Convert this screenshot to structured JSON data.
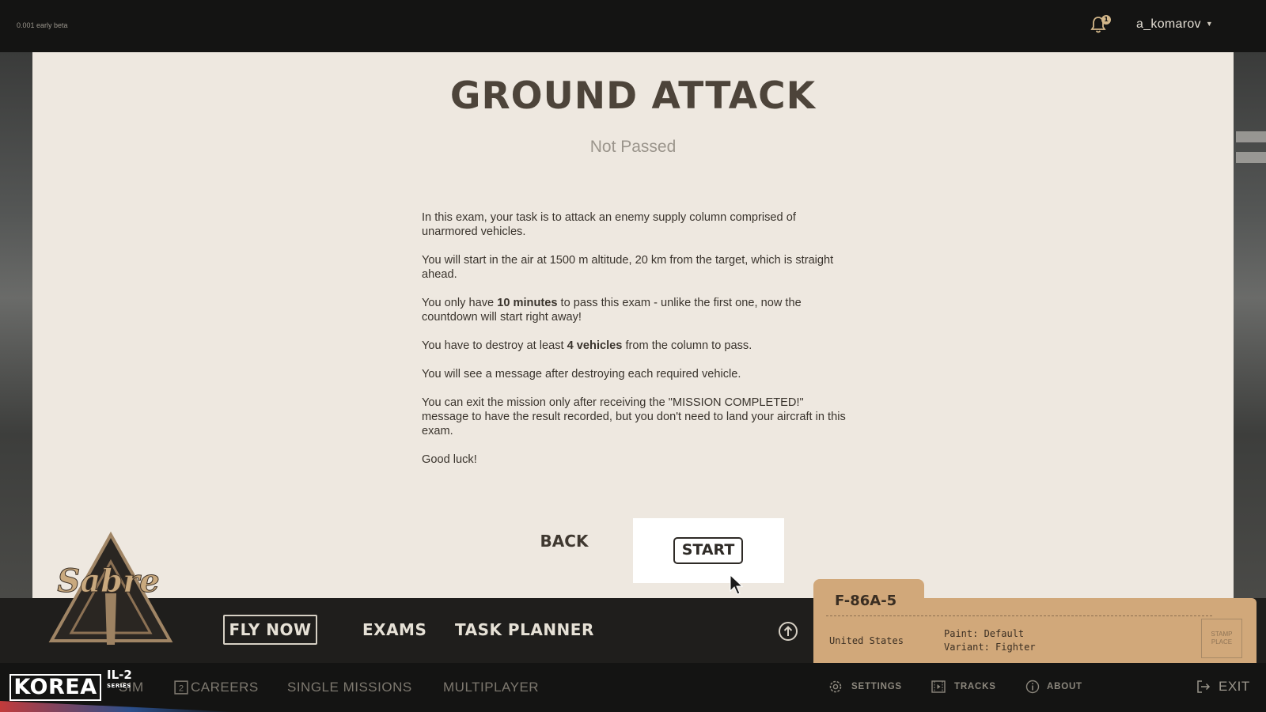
{
  "app": {
    "version": "0.001 early beta",
    "user": "a_komarov",
    "notifications": "1"
  },
  "exam": {
    "title": "GROUND ATTACK",
    "status": "Not Passed",
    "p1": "In this exam, your task is to attack an enemy supply column comprised of unarmored vehicles.",
    "p2": "You will start in the air at 1500 m altitude, 20 km from the target, which is straight ahead.",
    "p3_before": "You only have ",
    "p3_bold": "10 minutes",
    "p3_after": " to pass this exam - unlike the first one, now the countdown will start right away!",
    "p4_before": "You have to destroy at least ",
    "p4_bold": "4 vehicles",
    "p4_after": " from the column to pass.",
    "p5": "You will see a message after destroying each required vehicle.",
    "p6": "You can exit the mission only after receiving the \"MISSION COMPLETED!\" message to have the result recorded, but you don't need to land your aircraft in this exam.",
    "p7": "Good luck!",
    "back_label": "BACK",
    "start_label": "START"
  },
  "nav": {
    "fly_now": "FLY NOW",
    "exams": "EXAMS",
    "task_planner": "TASK PLANNER"
  },
  "aircraft": {
    "name": "F-86A-5",
    "country": "United States",
    "paint": "Paint: Default",
    "variant": "Variant: Fighter",
    "stamp": "STAMP PLACE"
  },
  "footer": {
    "hidden_item": "SIM",
    "careers": "CAREERS",
    "single_missions": "SINGLE MISSIONS",
    "multiplayer": "MULTIPLAYER",
    "settings": "SETTINGS",
    "tracks": "TRACKS",
    "about": "ABOUT",
    "exit": "EXIT"
  },
  "brand": {
    "korea": "KOREA",
    "il2": "IL-2",
    "series": "SERIES",
    "sabre": "Sabre"
  },
  "colors": {
    "paper": "#eee8e0",
    "card": "#d1a87a",
    "bar": "#1f1e1c"
  }
}
